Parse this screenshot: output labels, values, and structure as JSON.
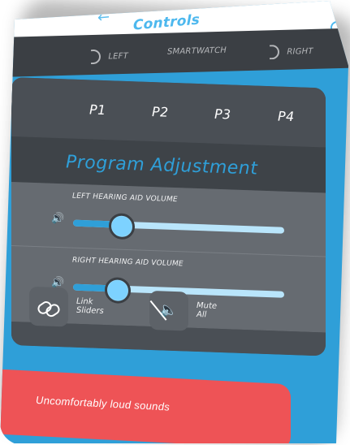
{
  "window": {
    "title": "Controls"
  },
  "devices": {
    "left": "LEFT",
    "smartwatch": "SMARTWATCH",
    "right": "RIGHT"
  },
  "programs": [
    "P1",
    "P2",
    "P3",
    "P4"
  ],
  "program_adjustment": {
    "title": "Program Adjustment"
  },
  "sliders": {
    "left_label": "LEFT HEARING AID VOLUME",
    "right_label": "RIGHT HEARING AID VOLUME",
    "left_value_percent": 22,
    "right_value_percent": 20
  },
  "controls": {
    "link_line1": "Link",
    "link_line2": "Sliders",
    "mute_line1": "Mute",
    "mute_line2": "All"
  },
  "alert_button": {
    "label": "Uncomfortably loud sounds"
  },
  "icons": {
    "back": "back-arrow-icon",
    "top_right": "refresh-icon",
    "left_ear": "ear-icon",
    "right_ear": "ear-icon",
    "speaker": "speaker-icon",
    "link": "link-icon",
    "mute": "mute-icon"
  },
  "colors": {
    "accent": "#2f9fd8",
    "panel": "#4a4f55",
    "slider_bg": "#666b71",
    "alert": "#ee5356"
  }
}
